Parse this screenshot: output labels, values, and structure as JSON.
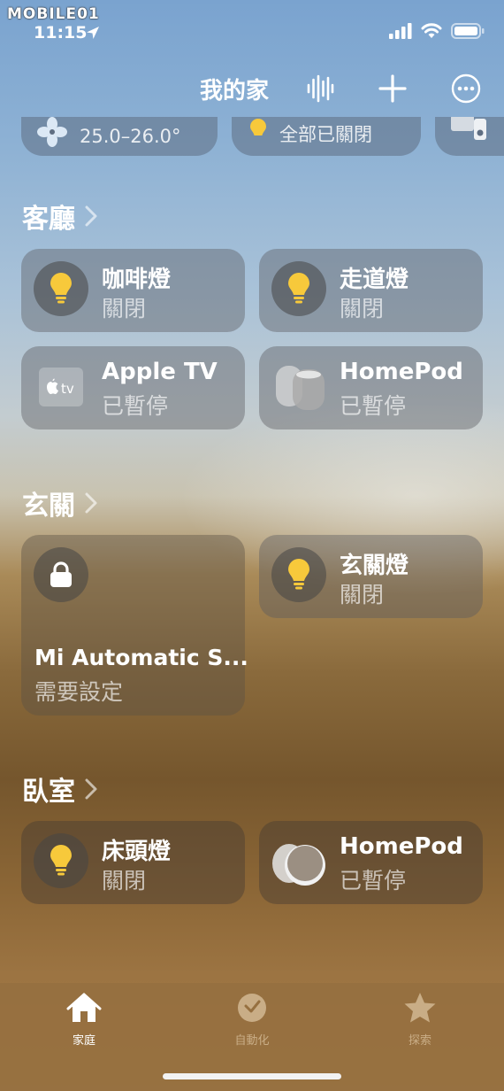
{
  "watermark": "MOBILE01",
  "status_bar": {
    "time": "11:15"
  },
  "header": {
    "title": "我的家"
  },
  "top_chips": [
    {
      "sub": "25.0–26.0°",
      "icon": "fan-icon"
    },
    {
      "sub": "全部已關閉",
      "icon": "lightbulb-icon"
    },
    {
      "sub": "",
      "icon": "tv-speaker-icon"
    }
  ],
  "rooms": [
    {
      "name": "客廳",
      "accessories": [
        {
          "name": "咖啡燈",
          "state": "關閉",
          "icon": "lightbulb-icon"
        },
        {
          "name": "走道燈",
          "state": "關閉",
          "icon": "lightbulb-icon"
        },
        {
          "name": "Apple TV",
          "state": "已暫停",
          "icon": "apple-tv-icon"
        },
        {
          "name": "HomePod",
          "state": "已暫停",
          "icon": "homepod-icon"
        }
      ]
    },
    {
      "name": "玄關",
      "accessories": [
        {
          "name": "Mi Automatic S...",
          "state": "需要設定",
          "icon": "lock-icon"
        },
        {
          "name": "玄關燈",
          "state": "關閉",
          "icon": "lightbulb-icon"
        }
      ]
    },
    {
      "name": "臥室",
      "accessories": [
        {
          "name": "床頭燈",
          "state": "關閉",
          "icon": "lightbulb-icon"
        },
        {
          "name": "HomePod",
          "state": "已暫停",
          "icon": "homepod-icon"
        }
      ]
    }
  ],
  "tabs": [
    {
      "label": "家庭",
      "icon": "house-icon",
      "active": true
    },
    {
      "label": "自動化",
      "icon": "clock-icon",
      "active": false
    },
    {
      "label": "探索",
      "icon": "star-icon",
      "active": false
    }
  ],
  "colors": {
    "bulb": "#f7c93b",
    "tabbar": "#967040",
    "tab_inactive": "#c9ad86"
  }
}
